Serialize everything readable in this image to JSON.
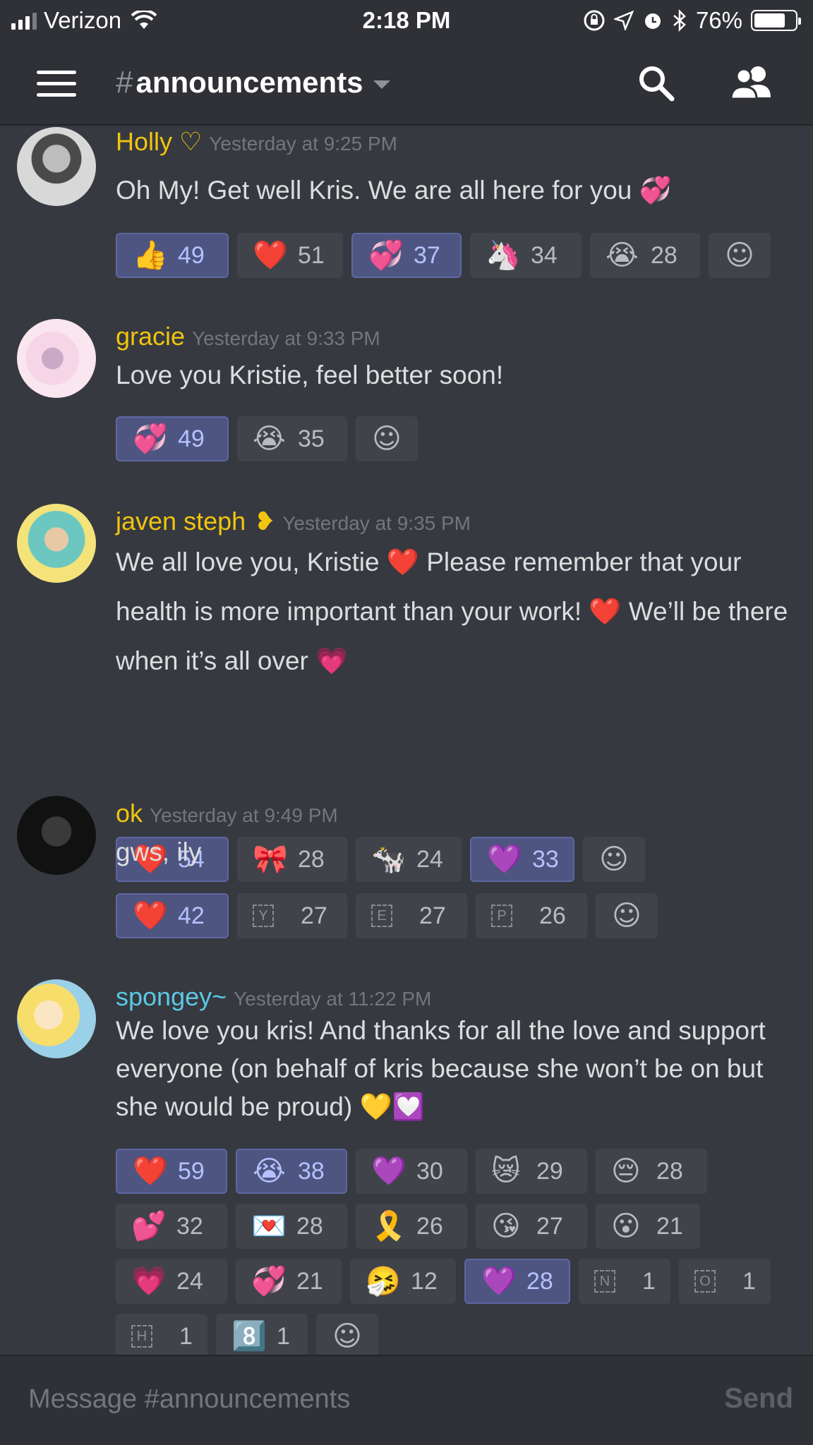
{
  "status_bar": {
    "carrier": "Verizon",
    "time": "2:18 PM",
    "battery": "76%",
    "battery_level": 0.76
  },
  "header": {
    "hash": "#",
    "channel": "announcements"
  },
  "colors": {
    "accent": "#7289da",
    "username_gold": "#f1c40f",
    "username_cyan": "#5bc8e6",
    "active_reaction": "#4e5581"
  },
  "messages": [
    {
      "author": "Holly ♡",
      "time": "Yesterday at 9:25 PM",
      "text": "Oh My! Get well Kris. We are all here for you 💞",
      "reactions": [
        {
          "emoji": "👍",
          "count": "49",
          "active": true
        },
        {
          "emoji": "❤️",
          "count": "51",
          "active": false
        },
        {
          "emoji": "💞",
          "count": "37",
          "active": true
        },
        {
          "emoji": "🦄",
          "count": "34",
          "active": false
        },
        {
          "emoji": "😭",
          "count": "28",
          "active": false
        }
      ]
    },
    {
      "author": "gracie",
      "time": "Yesterday at 9:33 PM",
      "text": "Love you Kristie, feel better soon!",
      "reactions": [
        {
          "emoji": "💞",
          "count": "49",
          "active": true
        },
        {
          "emoji": "😭",
          "count": "35",
          "active": false
        }
      ]
    },
    {
      "author": "javen steph",
      "time": "Yesterday at 9:35 PM",
      "text": "We all love you, Kristie ❤️ Please remember that your health is more important than your work! ❤️ We’ll be there when it’s all over 💗",
      "reactions": [
        {
          "emoji": "❤️",
          "count": "54",
          "active": true
        },
        {
          "emoji": "🎀",
          "count": "28",
          "active": false
        },
        {
          "emoji": "🐄",
          "count": "24",
          "active": false
        },
        {
          "emoji": "💜",
          "count": "33",
          "active": true
        }
      ]
    },
    {
      "author": "ok",
      "time": "Yesterday at 9:49 PM",
      "text": "gws, ily",
      "reactions": [
        {
          "emoji": "❤️",
          "count": "42",
          "active": true
        },
        {
          "letter": "Y",
          "count": "27",
          "active": false
        },
        {
          "letter": "E",
          "count": "27",
          "active": false
        },
        {
          "letter": "P",
          "count": "26",
          "active": false
        }
      ]
    },
    {
      "author": "spongey~",
      "time": "Yesterday at 11:22 PM",
      "text": "We love you kris! And thanks for all the love and support everyone (on behalf of kris because she won’t be on but she would be proud) 💛💟",
      "reactions": [
        {
          "emoji": "❤️",
          "count": "59",
          "active": true
        },
        {
          "emoji": "😭",
          "count": "38",
          "active": true
        },
        {
          "emoji": "💜",
          "count": "30",
          "active": false
        },
        {
          "emoji": "😿",
          "count": "29",
          "active": false
        },
        {
          "emoji": "😔",
          "count": "28",
          "active": false
        },
        {
          "emoji": "💕",
          "count": "32",
          "active": false
        },
        {
          "emoji": "💌",
          "count": "28",
          "active": false
        },
        {
          "emoji": "🎗️",
          "count": "26",
          "active": false
        },
        {
          "emoji": "😘",
          "count": "27",
          "active": false
        },
        {
          "emoji": "😮",
          "count": "21",
          "active": false
        },
        {
          "emoji": "💗",
          "count": "24",
          "active": false
        },
        {
          "emoji": "💞",
          "count": "21",
          "active": false
        },
        {
          "emoji": "🤧",
          "count": "12",
          "active": false
        },
        {
          "emoji": "💜",
          "count": "28",
          "active": true
        },
        {
          "letter": "N",
          "count": "1",
          "active": false
        },
        {
          "letter": "O",
          "count": "1",
          "active": false
        },
        {
          "letter": "H",
          "count": "1",
          "active": false
        },
        {
          "emoji": "8️⃣",
          "count": "1",
          "active": false
        }
      ]
    }
  ],
  "input": {
    "placeholder": "Message #announcements",
    "send_label": "Send"
  }
}
